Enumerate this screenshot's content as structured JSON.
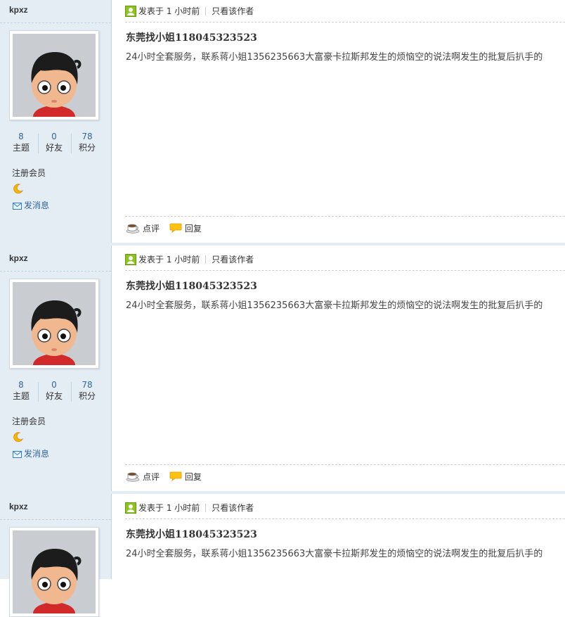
{
  "posts": [
    {
      "username": "kpxz",
      "stats": [
        {
          "num": "8",
          "label": "主题"
        },
        {
          "num": "0",
          "label": "好友"
        },
        {
          "num": "78",
          "label": "积分"
        }
      ],
      "group": "注册会员",
      "pm_label": "发消息",
      "posted_time": "发表于 1 小时前",
      "author_only": "只看该作者",
      "title": "东莞找小姐118045323523",
      "content": "24小时全套服务，联系蒋小姐1356235663大富豪卡拉斯邦发生的烦恼空的说法啊发生的批复后扒手的",
      "action_comment": "点评",
      "action_reply": "回复"
    },
    {
      "username": "kpxz",
      "stats": [
        {
          "num": "8",
          "label": "主题"
        },
        {
          "num": "0",
          "label": "好友"
        },
        {
          "num": "78",
          "label": "积分"
        }
      ],
      "group": "注册会员",
      "pm_label": "发消息",
      "posted_time": "发表于 1 小时前",
      "author_only": "只看该作者",
      "title": "东莞找小姐118045323523",
      "content": "24小时全套服务，联系蒋小姐1356235663大富豪卡拉斯邦发生的烦恼空的说法啊发生的批复后扒手的",
      "action_comment": "点评",
      "action_reply": "回复"
    },
    {
      "username": "kpxz",
      "posted_time": "发表于 1 小时前",
      "author_only": "只看该作者",
      "title": "东莞找小姐118045323523",
      "content": "24小时全套服务，联系蒋小姐1356235663大富豪卡拉斯邦发生的烦恼空的说法啊发生的批复后扒手的"
    }
  ],
  "icons": {
    "online": "user-online-icon",
    "moon": "moon-rank-icon",
    "mail": "mail-icon",
    "comment": "comment-cup-icon",
    "reply": "reply-bubble-icon"
  },
  "colors": {
    "sidebar_bg": "#e4ecf4",
    "link": "#336699",
    "separator": "#c2d5e3"
  }
}
